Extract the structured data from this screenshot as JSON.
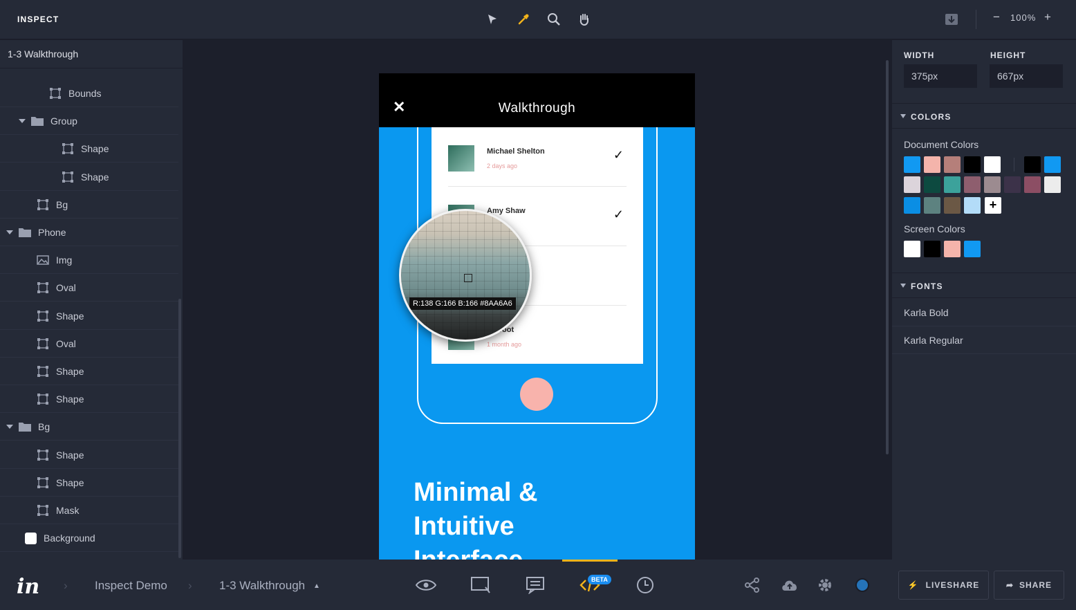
{
  "app": {
    "mode_title": "INSPECT",
    "zoom": "100%",
    "colors": {
      "accent": "#f2b31b",
      "panel": "#252a37",
      "canvas": "#1c1f2b",
      "artboard_blue": "#0a98f0"
    }
  },
  "toolbar": {
    "tools": [
      "pointer-icon",
      "eyedropper-icon",
      "search-icon",
      "hand-icon"
    ],
    "zoom_minus": "−",
    "zoom_plus": "+"
  },
  "layers": {
    "screen_name": "1-3 Walkthrough",
    "items": [
      {
        "label": "Bounds",
        "type": "shape",
        "depth": 2
      },
      {
        "label": "Group",
        "type": "folder",
        "depth": 1
      },
      {
        "label": "Shape",
        "type": "shape",
        "depth": 3
      },
      {
        "label": "Shape",
        "type": "shape",
        "depth": 3
      },
      {
        "label": "Bg",
        "type": "shape",
        "depth": 1
      },
      {
        "label": "Phone",
        "type": "folder",
        "depth": 0
      },
      {
        "label": "Img",
        "type": "image",
        "depth": 1
      },
      {
        "label": "Oval",
        "type": "shape",
        "depth": 1
      },
      {
        "label": "Shape",
        "type": "shape",
        "depth": 1
      },
      {
        "label": "Oval",
        "type": "shape",
        "depth": 1
      },
      {
        "label": "Shape",
        "type": "shape",
        "depth": 1
      },
      {
        "label": "Shape",
        "type": "shape",
        "depth": 1
      },
      {
        "label": "Bg",
        "type": "folder",
        "depth": 0
      },
      {
        "label": "Shape",
        "type": "shape",
        "depth": 1
      },
      {
        "label": "Shape",
        "type": "shape",
        "depth": 1
      },
      {
        "label": "Mask",
        "type": "shape",
        "depth": 1
      },
      {
        "label": "Background",
        "type": "swatch",
        "depth": 0
      }
    ]
  },
  "artboard": {
    "close": "✕",
    "title": "Walkthrough",
    "rows": [
      {
        "name": "Michael Shelton",
        "ago": "2 days ago",
        "check": "✓"
      },
      {
        "name": "Amy Shaw",
        "ago": "",
        "check": "✓"
      },
      {
        "name": "",
        "ago": "",
        "check": ""
      },
      {
        "name": "e Groot",
        "ago": "1 month ago",
        "check": ""
      }
    ],
    "headline_line1": "Minimal &",
    "headline_line2": "Intuitive",
    "headline_line3": "Interface",
    "magnifier_readout": "R:138 G:166 B:166 #8AA6A6"
  },
  "inspector": {
    "width_label": "WIDTH",
    "height_label": "HEIGHT",
    "width_value": "375px",
    "height_value": "667px",
    "colors_title": "COLORS",
    "document_colors_label": "Document Colors",
    "document_colors": [
      "#1199f2",
      "#f4b4ab",
      "#b57f7a",
      "#000000",
      "#ffffff",
      "#000000",
      "#1199f2",
      "#dcd4db",
      "#0d4a40",
      "#3ca29b",
      "#8e5e6e",
      "#9c8b90",
      "#3c3249",
      "#8c4e64",
      "#ececec",
      "#0a8ee4",
      "#5d8280",
      "#6b5845",
      "#b3dcf8"
    ],
    "add_color": "+",
    "screen_colors_label": "Screen Colors",
    "screen_colors": [
      "#ffffff",
      "#000000",
      "#f4b4ab",
      "#1199f2"
    ],
    "fonts_title": "FONTS",
    "fonts": [
      "Karla Bold",
      "Karla Regular"
    ]
  },
  "bottom": {
    "project": "Inspect Demo",
    "screen": "1-3 Walkthrough",
    "beta": "BETA",
    "liveshare": "LIVESHARE",
    "share": "SHARE"
  }
}
